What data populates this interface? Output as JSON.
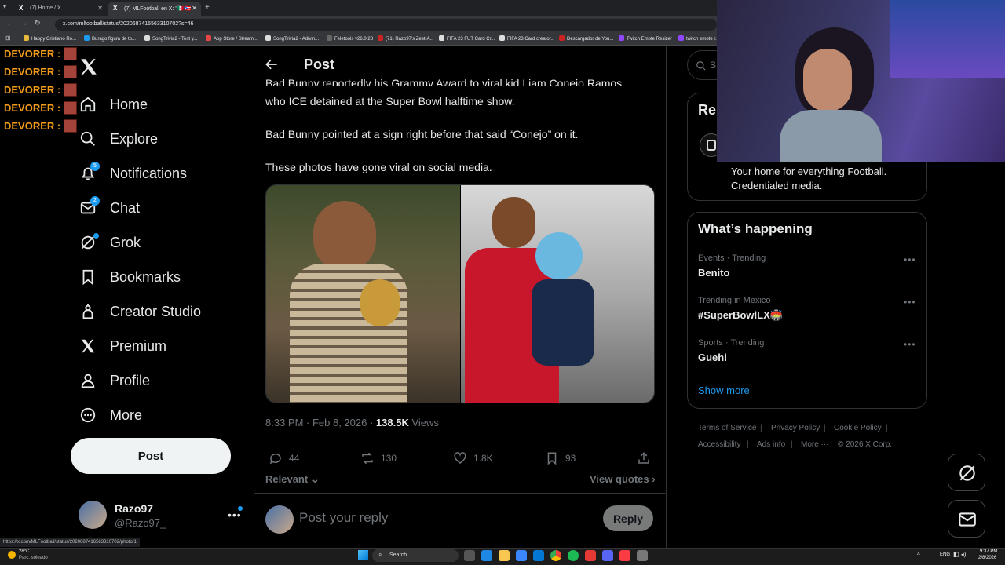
{
  "browser": {
    "tabs": [
      {
        "title": "(7) Home / X",
        "active": false
      },
      {
        "title": "(7) MLFootball en X: \"🇲🇽🇵🇷",
        "active": true
      }
    ],
    "url": "x.com/mlfootball/status/2020687416563310702?s=46",
    "bookmarks": [
      "Happy Cristiano Ro...",
      "Burago figura de to...",
      "SongTrivia2 - Test y...",
      "App Store / Streami...",
      "SongTrivia2 - Adivin...",
      "Feletools v26.0.28",
      "(71) Razo97's Zest-A...",
      "FIFA 23 FUT Card Cr...",
      "FIFA 23 Card creator...",
      "Descargador de You...",
      "Twitch Emote Resizer",
      "twitch emote r..."
    ],
    "status_url": "https://x.com/MLFootball/status/2020687416563310702/photo/1"
  },
  "chat_overlay": {
    "lines": [
      "DEVORER :",
      "DEVORER :",
      "DEVORER :",
      "DEVORER :",
      "DEVORER :"
    ]
  },
  "sidebar": {
    "items": [
      {
        "label": "Home",
        "icon": "home-icon"
      },
      {
        "label": "Explore",
        "icon": "search-icon"
      },
      {
        "label": "Notifications",
        "icon": "bell-icon",
        "badge": "5"
      },
      {
        "label": "Chat",
        "icon": "mail-icon",
        "badge": "2"
      },
      {
        "label": "Grok",
        "icon": "grok-icon"
      },
      {
        "label": "Bookmarks",
        "icon": "bookmark-icon"
      },
      {
        "label": "Creator Studio",
        "icon": "creator-icon"
      },
      {
        "label": "Premium",
        "icon": "x-logo-icon"
      },
      {
        "label": "Profile",
        "icon": "person-icon"
      },
      {
        "label": "More",
        "icon": "more-circle-icon"
      }
    ],
    "post_button": "Post",
    "account": {
      "name": "Razo97",
      "handle": "@Razo97_"
    }
  },
  "post": {
    "header": "Post",
    "text_lines": [
      "Bad Bunny reportedly his Grammy Award to viral kid Liam Conejo Ramos",
      "who ICE detained at the Super Bowl halftime show.",
      "Bad Bunny pointed at a sign right before that said “Conejo” on it.",
      "These photos have gone viral on social media."
    ],
    "timestamp": "8:33 PM · Feb 8, 2026 ·",
    "views_count": "138.5K",
    "views_label": "Views",
    "actions": {
      "replies": "44",
      "reposts": "130",
      "likes": "1.8K",
      "bookmarks": "93"
    },
    "sort_label": "Relevant",
    "view_quotes": "View quotes",
    "reply_placeholder": "Post your reply",
    "reply_button": "Reply"
  },
  "right": {
    "search_placeholder": "S",
    "relevant_title": "Rel",
    "bio_lines": [
      "Your home for everything Football.",
      "Credentialed media."
    ],
    "happening_title": "What’s happening",
    "trends": [
      {
        "category": "Events · Trending",
        "name": "Benito"
      },
      {
        "category": "Trending in Mexico",
        "name": "#SuperBowlLX🏟️"
      },
      {
        "category": "Sports · Trending",
        "name": "Guehi"
      }
    ],
    "show_more": "Show more",
    "footer": [
      "Terms of Service",
      "Privacy Policy",
      "Cookie Policy",
      "Accessibility",
      "Ads info",
      "More ···",
      "© 2026 X Corp."
    ]
  },
  "taskbar": {
    "weather_temp": "28°C",
    "weather_desc": "Parc. soleado",
    "search": "Search",
    "lang": "ENG",
    "time": "9:37 PM",
    "date": "2/8/2026"
  },
  "colors": {
    "accent": "#1d9bf0",
    "background": "#000000",
    "border": "#2f3336",
    "muted": "#71767b",
    "chat_name": "#f29a1a"
  }
}
